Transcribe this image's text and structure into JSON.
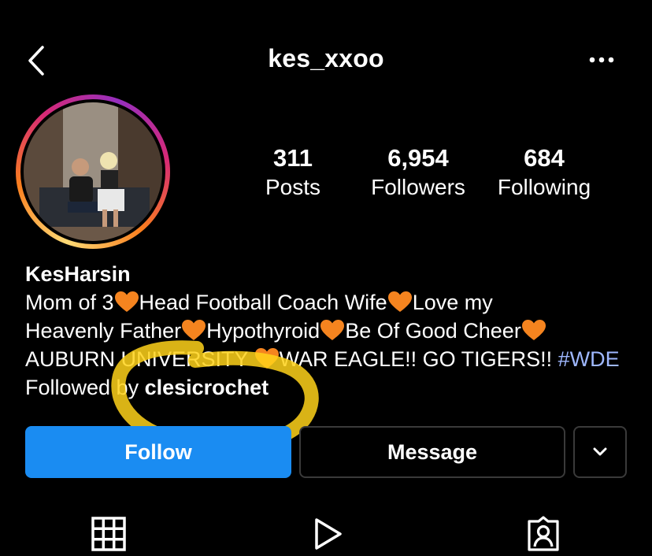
{
  "header": {
    "username": "kes_xxoo",
    "back_icon": "chevron-left-icon",
    "more_icon": "more-horizontal-icon"
  },
  "stats": [
    {
      "value": "311",
      "label": "Posts"
    },
    {
      "value": "6,954",
      "label": "Followers"
    },
    {
      "value": "684",
      "label": "Following"
    }
  ],
  "bio": {
    "name": "KesHarsin",
    "line1_a": "Mom of 3",
    "line1_b": "Head Football Coach Wife",
    "line1_c": "Love my",
    "line2_a": "Heavenly Father",
    "line2_b": "Hypothyroid",
    "line2_c": "Be Of Good Cheer",
    "line3_a": "AUBURN UNIVERSITY ",
    "line3_b": "WAR EAGLE!! GO TIGERS!! ",
    "line3_hashtag": "#WDE",
    "followed_prefix": "Followed by ",
    "followed_user": "clesicrochet"
  },
  "actions": {
    "follow_label": "Follow",
    "message_label": "Message",
    "more_icon": "chevron-down-icon"
  },
  "tabs": [
    {
      "icon": "grid-icon"
    },
    {
      "icon": "reels-play-icon"
    },
    {
      "icon": "tagged-person-icon"
    }
  ],
  "colors": {
    "follow_button": "#1a8cf2",
    "heart": "#f5841f",
    "hashtag": "#9fb8ff",
    "highlight": "#ffd21a",
    "background": "#000000"
  }
}
